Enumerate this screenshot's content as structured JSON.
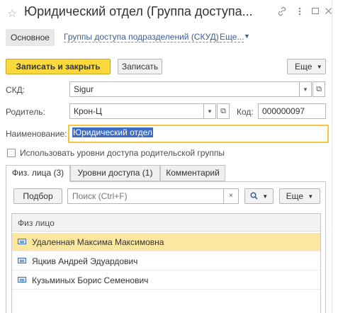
{
  "window": {
    "title": "Юридический отдел (Группа доступа...",
    "icons": [
      "star-icon",
      "link-icon",
      "more-icon",
      "maximize-icon",
      "close-icon"
    ]
  },
  "nav": {
    "main": "Основное",
    "link1": "Группы доступа подразделений (СКУД)",
    "link2": "Еще..."
  },
  "commands": {
    "save_close": "Записать и закрыть",
    "save": "Записать",
    "more": "Еще"
  },
  "form": {
    "skd_label": "СКД:",
    "skd_value": "Sigur",
    "parent_label": "Родитель:",
    "parent_value": "Крон-Ц",
    "code_label": "Код:",
    "code_value": "000000097",
    "name_label": "Наименование:",
    "name_value": "Юридический отдел",
    "use_parent_levels_label": "Использовать уровни доступа родительской группы",
    "use_parent_levels_checked": false
  },
  "tabs": [
    {
      "label": "Физ. лица (3)",
      "active": true
    },
    {
      "label": "Уровни доступа (1)",
      "active": false
    },
    {
      "label": "Комментарий",
      "active": false
    }
  ],
  "table_toolbar": {
    "pick": "Подбор",
    "search_placeholder": "Поиск (Ctrl+F)",
    "more": "Еще"
  },
  "table": {
    "column": "Физ лицо",
    "rows": [
      {
        "name": "Удаленная Максима Максимовна",
        "current": true
      },
      {
        "name": "Яцкив Андрей Эдуардович",
        "current": false
      },
      {
        "name": "Кузьминых Борис Семенович",
        "current": false
      }
    ]
  },
  "colors": {
    "accent_button": "#fbd93d",
    "link": "#3d5e92",
    "selection": "#3c6cc4",
    "current_row": "#fbe7a0",
    "focus_border": "#f4c542"
  }
}
